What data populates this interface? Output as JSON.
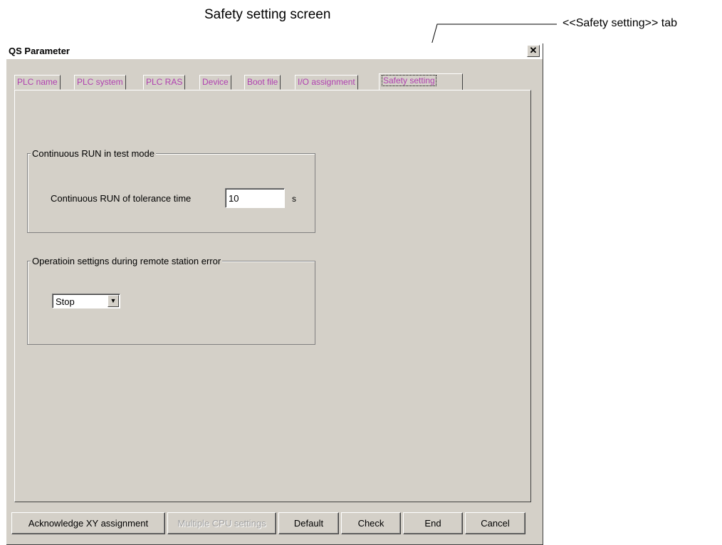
{
  "captions": {
    "screen": "Safety setting screen",
    "tab_pointer": "<<Safety setting>> tab"
  },
  "window": {
    "title": "QS Parameter",
    "close_glyph": "✕"
  },
  "tabs": [
    {
      "label": "PLC name",
      "active": false
    },
    {
      "label": "PLC system",
      "active": false
    },
    {
      "label": "PLC RAS",
      "active": false
    },
    {
      "label": "Device",
      "active": false
    },
    {
      "label": "Boot file",
      "active": false
    },
    {
      "label": "I/O assignment",
      "active": false
    },
    {
      "label": "Safety setting",
      "active": true
    }
  ],
  "continuous_run": {
    "group_label": "Continuous RUN in test mode",
    "field_label": "Continuous RUN of tolerance time",
    "value": "10",
    "unit": "s"
  },
  "remote_error": {
    "group_label": "Operatioin settigns during remote station error",
    "selected": "Stop"
  },
  "buttons": {
    "acknowledge": "Acknowledge XY assignment",
    "multiple_cpu": "Multiple CPU settings",
    "default": "Default",
    "check": "Check",
    "end": "End",
    "cancel": "Cancel"
  },
  "colors": {
    "tab_text": "#b040b0",
    "window_bg": "#d4d0c8"
  }
}
